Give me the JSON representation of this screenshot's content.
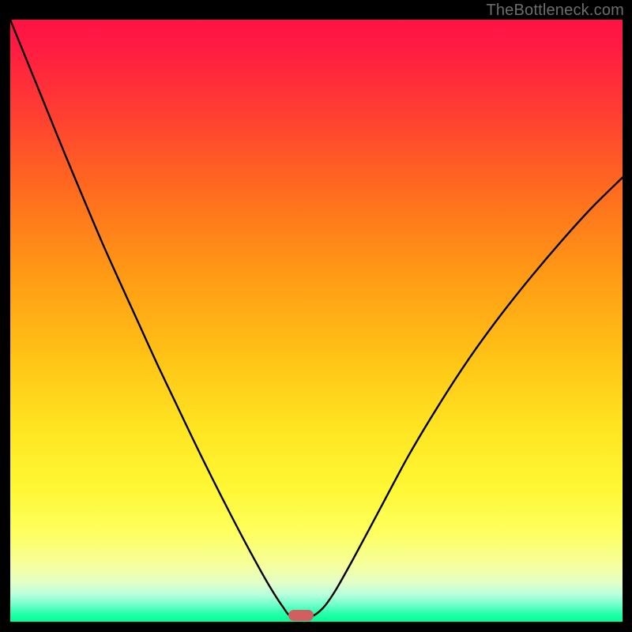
{
  "watermark": "TheBottleneck.com",
  "marker": {
    "x_frac": 0.475,
    "y_frac": 0.99
  },
  "chart_data": {
    "type": "line",
    "title": "",
    "xlabel": "",
    "ylabel": "",
    "xlim": [
      0,
      1
    ],
    "ylim": [
      0,
      1
    ],
    "note": "Axes are unlabeled in the source image; values below are fractional positions within the plot area (0=left/top, 1=right/bottom).",
    "series": [
      {
        "name": "curve",
        "x": [
          0.0,
          0.03,
          0.06,
          0.09,
          0.12,
          0.15,
          0.18,
          0.21,
          0.24,
          0.27,
          0.3,
          0.33,
          0.36,
          0.39,
          0.42,
          0.445,
          0.46,
          0.49,
          0.51,
          0.53,
          0.56,
          0.6,
          0.65,
          0.7,
          0.75,
          0.8,
          0.85,
          0.9,
          0.95,
          1.0
        ],
        "y": [
          0.0,
          0.075,
          0.15,
          0.225,
          0.298,
          0.37,
          0.438,
          0.505,
          0.572,
          0.636,
          0.7,
          0.762,
          0.822,
          0.88,
          0.935,
          0.975,
          0.992,
          0.992,
          0.978,
          0.95,
          0.896,
          0.82,
          0.725,
          0.64,
          0.562,
          0.492,
          0.428,
          0.368,
          0.312,
          0.262
        ]
      }
    ],
    "gradient_stops": [
      {
        "pos": 0.0,
        "color": "#ff1345"
      },
      {
        "pos": 0.04,
        "color": "#ff1a43"
      },
      {
        "pos": 0.14,
        "color": "#ff3934"
      },
      {
        "pos": 0.28,
        "color": "#ff6a1f"
      },
      {
        "pos": 0.42,
        "color": "#ff9915"
      },
      {
        "pos": 0.56,
        "color": "#ffc316"
      },
      {
        "pos": 0.68,
        "color": "#ffe522"
      },
      {
        "pos": 0.78,
        "color": "#fff835"
      },
      {
        "pos": 0.85,
        "color": "#feff5d"
      },
      {
        "pos": 0.905,
        "color": "#f6ff9a"
      },
      {
        "pos": 0.935,
        "color": "#e3ffc8"
      },
      {
        "pos": 0.955,
        "color": "#b7ffdd"
      },
      {
        "pos": 0.972,
        "color": "#6fffcb"
      },
      {
        "pos": 0.985,
        "color": "#2bffad"
      },
      {
        "pos": 1.0,
        "color": "#00ff95"
      }
    ]
  }
}
